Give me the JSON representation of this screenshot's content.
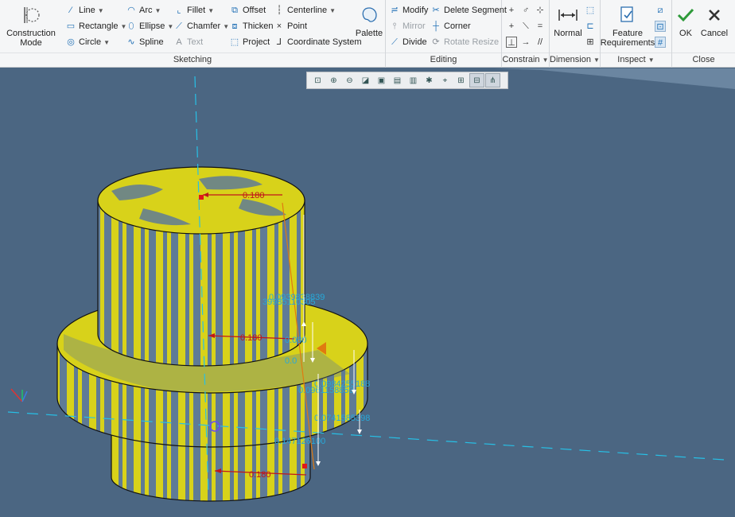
{
  "ribbon": {
    "sketching": {
      "label": "Sketching",
      "construction_mode": "Construction\nMode",
      "line": "Line",
      "rectangle": "Rectangle",
      "circle": "Circle",
      "arc": "Arc",
      "ellipse": "Ellipse",
      "spline": "Spline",
      "fillet": "Fillet",
      "chamfer": "Chamfer",
      "text": "Text",
      "offset": "Offset",
      "thicken": "Thicken",
      "project": "Project",
      "centerline": "Centerline",
      "point": "Point",
      "coordinate_system": "Coordinate System",
      "palette": "Palette"
    },
    "editing": {
      "label": "Editing",
      "modify": "Modify",
      "mirror": "Mirror",
      "divide": "Divide",
      "delete_segment": "Delete Segment",
      "corner": "Corner",
      "rotate_resize": "Rotate Resize"
    },
    "constrain": {
      "label": "Constrain"
    },
    "dimension": {
      "label": "Dimension",
      "normal": "Normal"
    },
    "inspect": {
      "label": "Inspect",
      "feature_requirements": "Feature\nRequirements"
    },
    "close": {
      "label": "Close",
      "ok": "OK",
      "cancel": "Cancel"
    }
  },
  "viewport": {
    "dimensions": {
      "top_radius": "0.180",
      "middle_radius": "0.180",
      "bottom_radius": "0.180",
      "dim_a": "0.0939838839",
      "dim_b": "39985110305",
      "dim_c": "0.0984255188",
      "dim_d": "0.0961158859",
      "dim_e": "0.0741585398",
      "dim_f": "0.147126100",
      "dim_g": "0.080",
      "dim_h": "0.0"
    }
  },
  "colors": {
    "ribbon_bg": "#f5f6f7",
    "viewport_bg": "#4b6682",
    "part_yellow": "#d8d21a",
    "part_blue": "#5f7b96",
    "dimension_red": "#c0161b",
    "dimension_cyan": "#27a8d8",
    "ok_green": "#2e9a3a"
  }
}
